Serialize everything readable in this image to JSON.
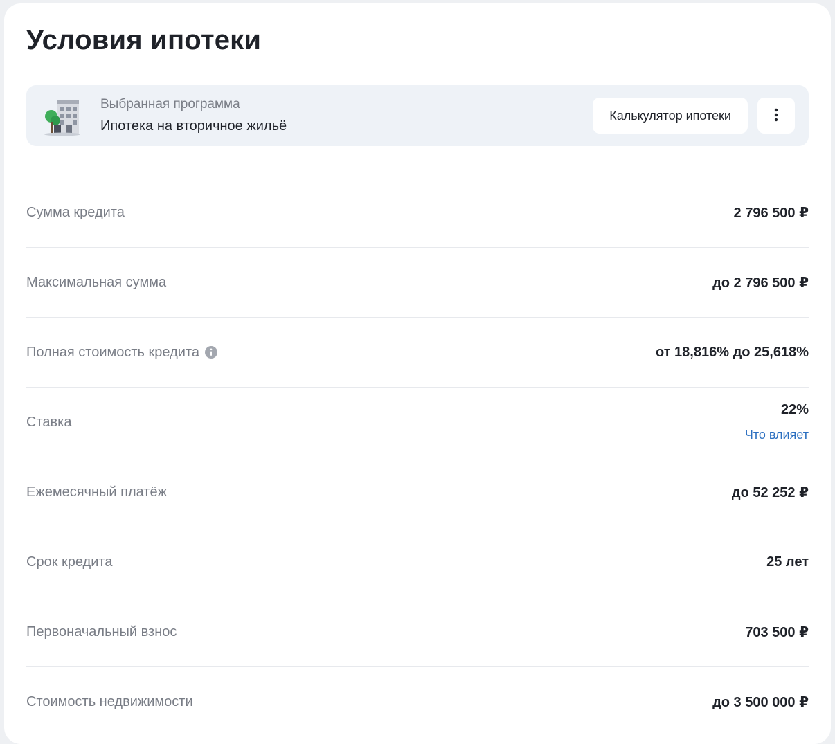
{
  "title": "Условия ипотеки",
  "program": {
    "caption": "Выбранная программа",
    "name": "Ипотека на вторичное жильё",
    "calc_button": "Калькулятор ипотеки"
  },
  "rows": [
    {
      "label": "Сумма кредита",
      "value": "2 796 500 ₽"
    },
    {
      "label": "Максимальная сумма",
      "value": "до 2 796 500 ₽"
    },
    {
      "label": "Полная стоимость кредита",
      "value": "от 18,816% до 25,618%"
    },
    {
      "label": "Ставка",
      "value": "22%",
      "link": "Что влияет"
    },
    {
      "label": "Ежемесячный платёж",
      "value": "до 52 252 ₽"
    },
    {
      "label": "Срок кредита",
      "value": "25 лет"
    },
    {
      "label": "Первоначальный взнос",
      "value": "703 500 ₽"
    },
    {
      "label": "Стоимость недвижимости",
      "value": "до 3 500 000 ₽"
    }
  ],
  "icons": {
    "program": "building-icon",
    "more": "more-vertical-icon",
    "info": "info-icon"
  },
  "colors": {
    "link": "#2b6fc0",
    "program_bg": "#eef2f7"
  }
}
